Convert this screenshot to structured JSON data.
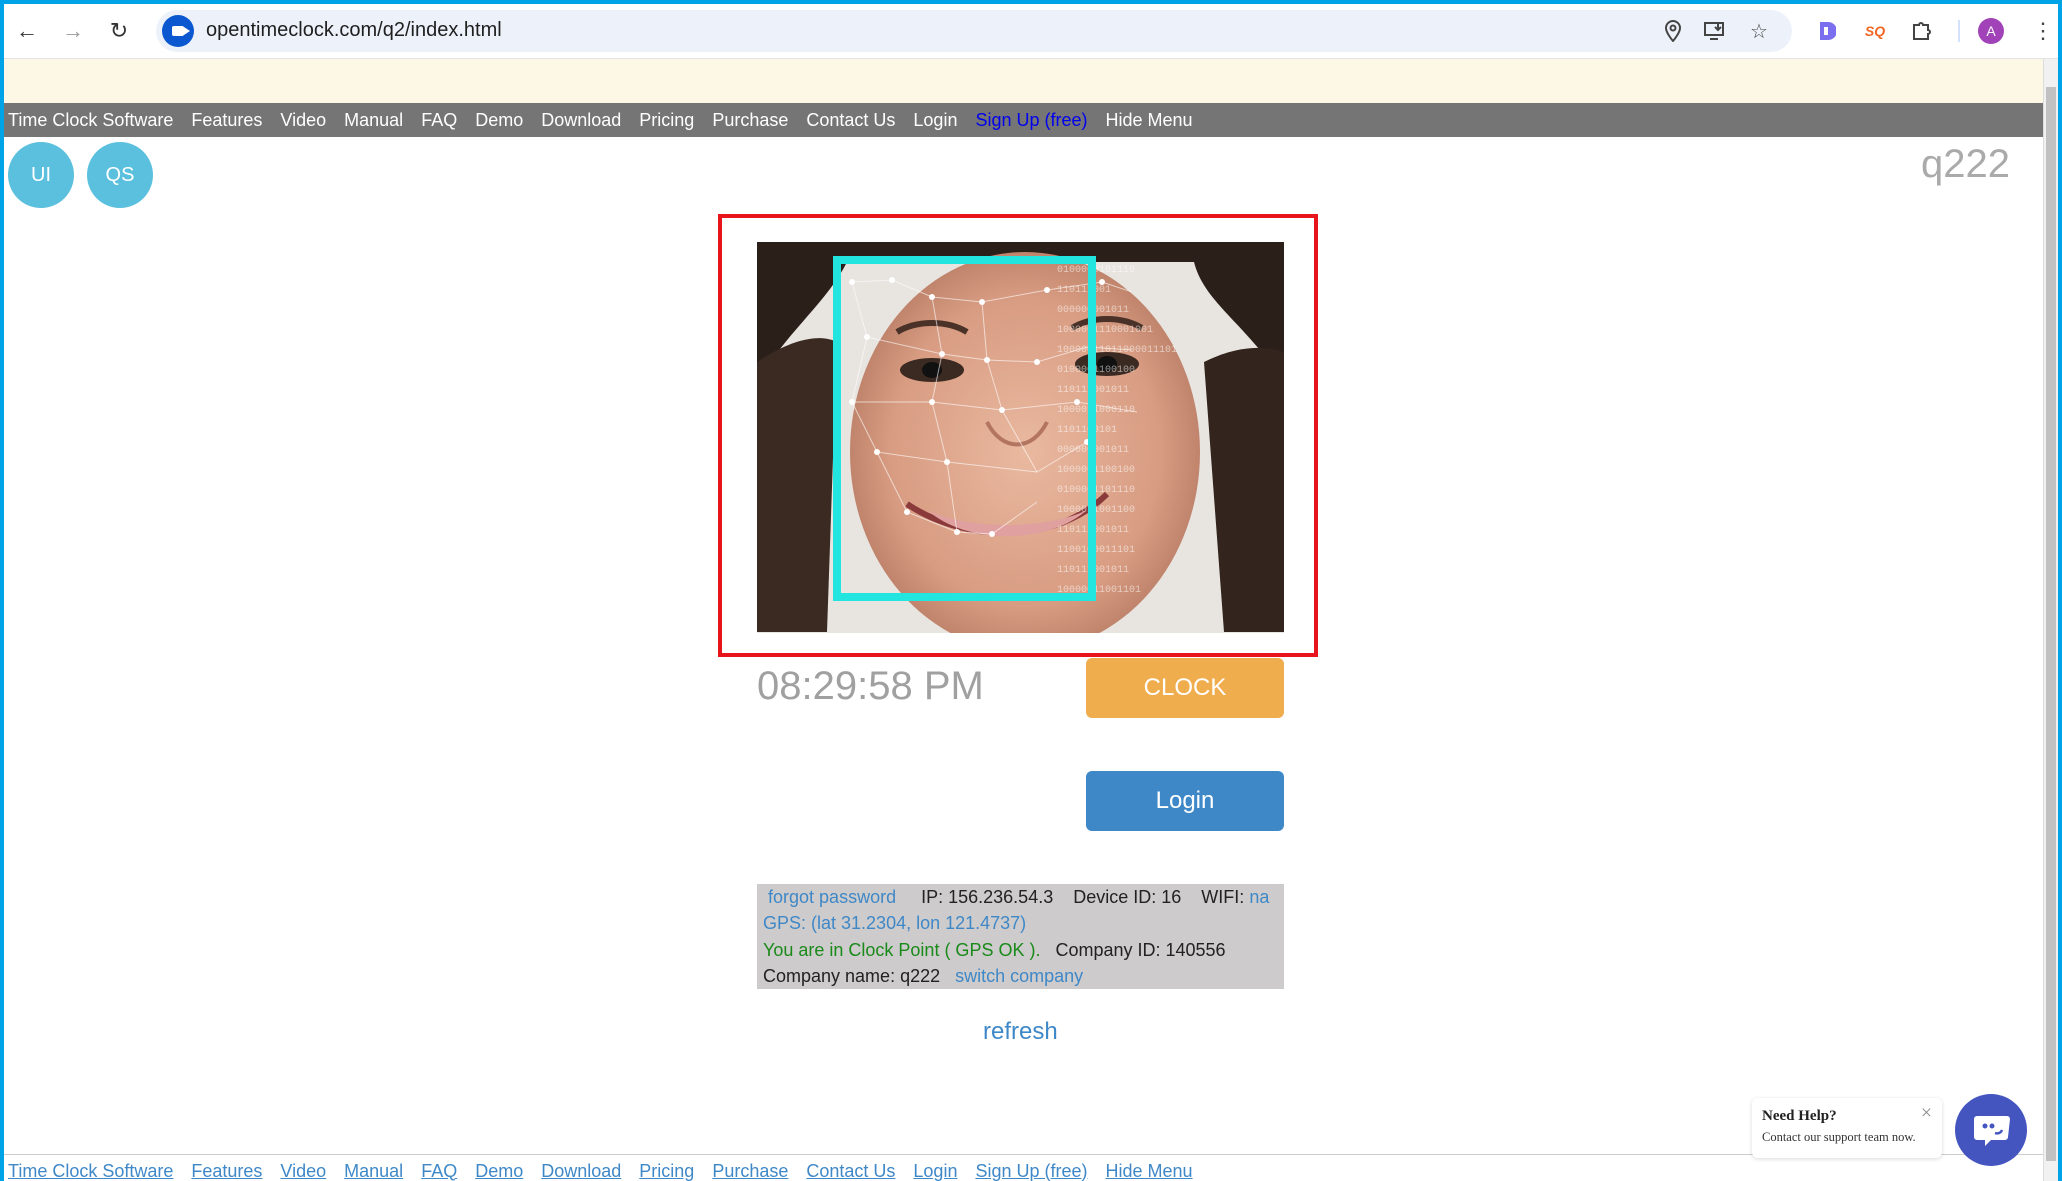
{
  "browser": {
    "url": "opentimeclock.com/q2/index.html",
    "profile_initial": "A",
    "icons": [
      "back-icon",
      "forward-icon",
      "reload-icon",
      "location-icon",
      "install-app-icon",
      "bookmark-star-icon",
      "extension-d-icon",
      "extension-sq-icon",
      "extensions-puzzle-icon",
      "menu-kebab-icon"
    ]
  },
  "nav": {
    "items": [
      "Time Clock Software",
      "Features",
      "Video",
      "Manual",
      "FAQ",
      "Demo",
      "Download",
      "Pricing",
      "Purchase",
      "Contact Us",
      "Login",
      "Sign Up (free)",
      "Hide Menu"
    ]
  },
  "shortcuts": {
    "ui": "UI",
    "qs": "QS"
  },
  "company_title": "q222",
  "clock": {
    "time": "08:29:58 PM",
    "clock_button": "CLOCK",
    "login_button": "Login"
  },
  "info": {
    "forgot_password": "forgot password",
    "ip": "IP: 156.236.54.3",
    "device_id": "Device ID: 16",
    "wifi_label": "WIFI:",
    "wifi_value": "na",
    "gps": "GPS: (lat 31.2304, lon 121.4737)",
    "clock_point": "You are in Clock Point ( GPS OK ).",
    "company_id": "Company ID: 140556",
    "company_name": "Company name: q222",
    "switch_company": "switch company"
  },
  "refresh": "refresh",
  "help": {
    "title": "Need Help?",
    "subtitle": "Contact our support team now.",
    "close": "×"
  },
  "colors": {
    "clock_button": "#f0ad4e",
    "login_button": "#3f88c8",
    "highlight_frame": "#e8141b",
    "face_box": "#22e5e0"
  }
}
